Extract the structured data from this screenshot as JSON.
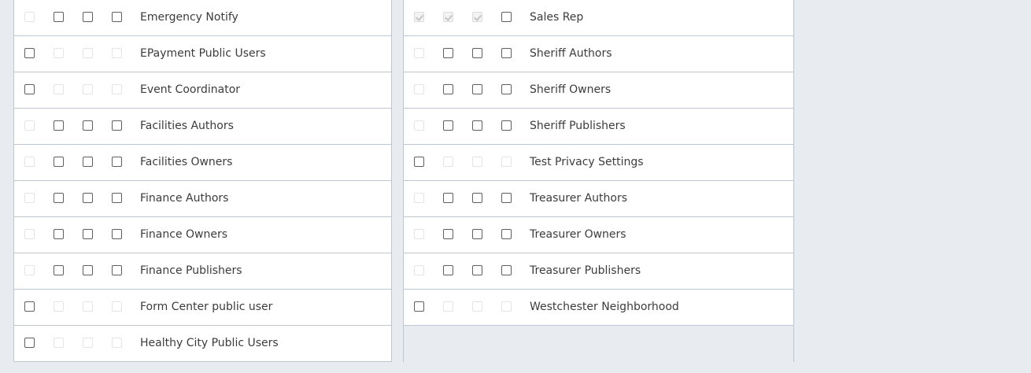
{
  "left_rows": [
    {
      "label": "Emergency Notify",
      "cb": [
        "disabled",
        "on",
        "on",
        "on"
      ]
    },
    {
      "label": "EPayment Public Users",
      "cb": [
        "on",
        "disabled",
        "disabled",
        "disabled"
      ]
    },
    {
      "label": "Event Coordinator",
      "cb": [
        "on",
        "disabled",
        "disabled",
        "disabled"
      ]
    },
    {
      "label": "Facilities Authors",
      "cb": [
        "disabled",
        "on",
        "on",
        "on"
      ]
    },
    {
      "label": "Facilities Owners",
      "cb": [
        "disabled",
        "on",
        "on",
        "on"
      ]
    },
    {
      "label": "Finance Authors",
      "cb": [
        "disabled",
        "on",
        "on",
        "on"
      ]
    },
    {
      "label": "Finance Owners",
      "cb": [
        "disabled",
        "on",
        "on",
        "on"
      ]
    },
    {
      "label": "Finance Publishers",
      "cb": [
        "disabled",
        "on",
        "on",
        "on"
      ]
    },
    {
      "label": "Form Center public user",
      "cb": [
        "on",
        "disabled",
        "disabled",
        "disabled"
      ]
    },
    {
      "label": "Healthy City Public Users",
      "cb": [
        "on",
        "disabled",
        "disabled",
        "disabled"
      ]
    }
  ],
  "right_rows": [
    {
      "label": "Sales Rep",
      "cb": [
        "checked-disabled",
        "checked-disabled",
        "checked-disabled",
        "on"
      ]
    },
    {
      "label": "Sheriff Authors",
      "cb": [
        "disabled",
        "on",
        "on",
        "on"
      ]
    },
    {
      "label": "Sheriff Owners",
      "cb": [
        "disabled",
        "on",
        "on",
        "on"
      ]
    },
    {
      "label": "Sheriff Publishers",
      "cb": [
        "disabled",
        "on",
        "on",
        "on"
      ]
    },
    {
      "label": "Test Privacy Settings",
      "cb": [
        "on",
        "disabled",
        "disabled",
        "disabled"
      ]
    },
    {
      "label": "Treasurer Authors",
      "cb": [
        "disabled",
        "on",
        "on",
        "on"
      ]
    },
    {
      "label": "Treasurer Owners",
      "cb": [
        "disabled",
        "on",
        "on",
        "on"
      ]
    },
    {
      "label": "Treasurer Publishers",
      "cb": [
        "disabled",
        "on",
        "on",
        "on"
      ]
    },
    {
      "label": "Westchester Neighborhood",
      "cb": [
        "on",
        "disabled",
        "disabled",
        "disabled"
      ]
    }
  ]
}
